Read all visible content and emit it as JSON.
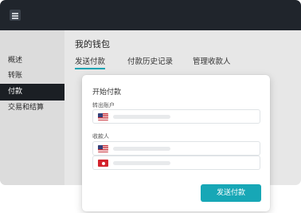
{
  "sidebar": {
    "items": [
      {
        "label": "概述",
        "active": false
      },
      {
        "label": "转账",
        "active": false
      },
      {
        "label": "付款",
        "active": true
      },
      {
        "label": "交易和结算",
        "active": false
      }
    ]
  },
  "main": {
    "title": "我的钱包",
    "tabs": [
      {
        "label": "发送付款",
        "active": true
      },
      {
        "label": "付款历史记录",
        "active": false
      },
      {
        "label": "管理收款人",
        "active": false
      }
    ]
  },
  "dialog": {
    "title": "开始付款",
    "from_label": "转出账户",
    "to_label": "收款人",
    "from_accounts": [
      {
        "flag_icon": "us-flag-icon"
      }
    ],
    "recipients": [
      {
        "flag_icon": "us-flag-icon"
      },
      {
        "flag_icon": "hk-flag-icon"
      }
    ],
    "send_button": "发送付款"
  },
  "colors": {
    "accent": "#17a7b6",
    "topbar": "#20252c",
    "sidebar_active": "#1b1f24"
  }
}
